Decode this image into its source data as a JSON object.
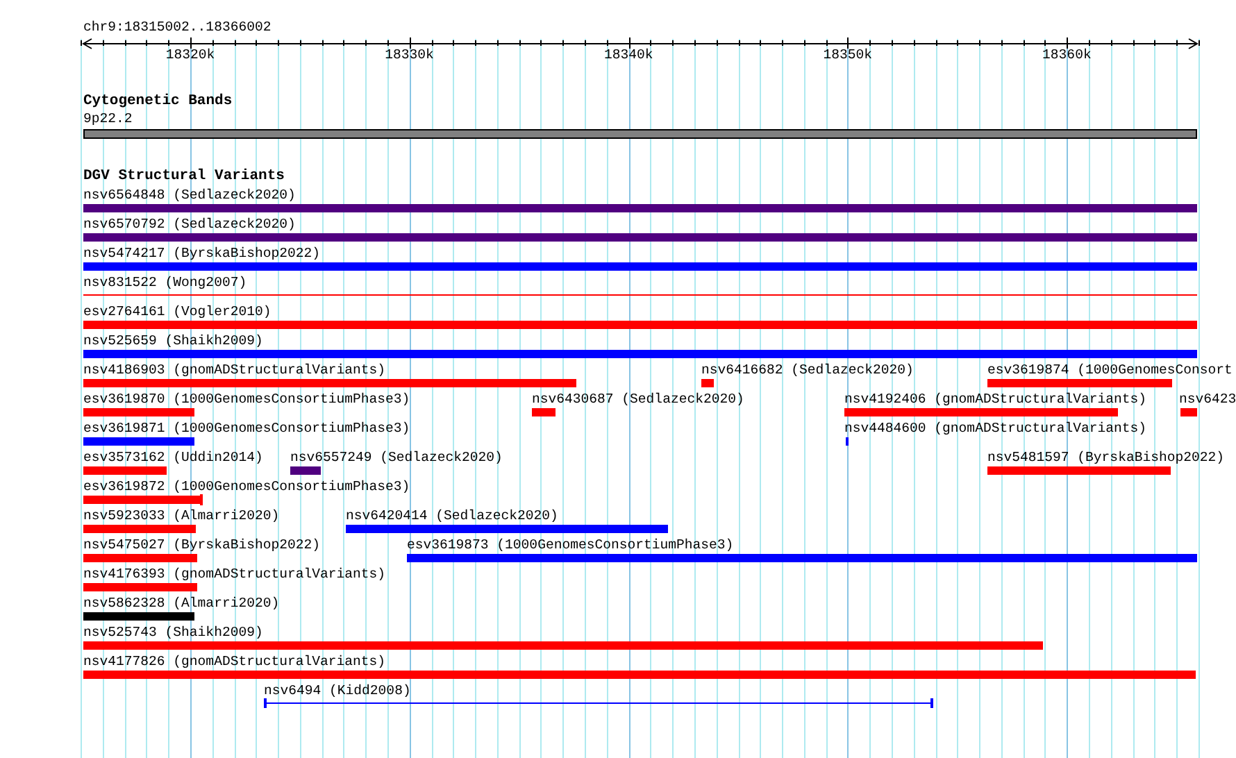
{
  "ruler": {
    "range": "chr9:18315002..18366002",
    "ticks": [
      "18320k",
      "18330k",
      "18340k",
      "18350k",
      "18360k"
    ]
  },
  "cytoband_track": {
    "title": "Cytogenetic Bands",
    "band": {
      "label": "9p22.2"
    }
  },
  "variant_track": {
    "title": "DGV Structural Variants",
    "rows": [
      {
        "features": [
          {
            "label": "nsv6564848 (Sedlazeck2020)",
            "color": "#500080",
            "kind": "bar"
          }
        ]
      },
      {
        "features": [
          {
            "label": "nsv6570792 (Sedlazeck2020)",
            "color": "#500080",
            "kind": "bar"
          }
        ]
      },
      {
        "features": [
          {
            "label": "nsv5474217 (ByrskaBishop2022)",
            "color": "#0000ff",
            "kind": "bar"
          }
        ]
      },
      {
        "features": [
          {
            "label": "nsv831522 (Wong2007)",
            "color": "#ff0000",
            "kind": "line"
          }
        ]
      },
      {
        "features": [
          {
            "label": "esv2764161 (Vogler2010)",
            "color": "#ff0000",
            "kind": "bar"
          }
        ]
      },
      {
        "features": [
          {
            "label": "nsv525659 (Shaikh2009)",
            "color": "#0000ff",
            "kind": "bar"
          }
        ]
      },
      {
        "features": [
          {
            "label": "nsv4186903 (gnomADStructuralVariants)",
            "color": "#ff0000",
            "kind": "bar"
          },
          {
            "label": "nsv6416682 (Sedlazeck2020)",
            "color": "#ff0000",
            "kind": "bar"
          },
          {
            "label": "esv3619874 (1000GenomesConsort",
            "color": "#ff0000",
            "kind": "bar"
          }
        ]
      },
      {
        "features": [
          {
            "label": "esv3619870 (1000GenomesConsortiumPhase3)",
            "color": "#ff0000",
            "kind": "bar"
          },
          {
            "label": "nsv6430687 (Sedlazeck2020)",
            "color": "#ff0000",
            "kind": "bar"
          },
          {
            "label": "nsv4192406 (gnomADStructuralVariants)",
            "color": "#ff0000",
            "kind": "bar"
          },
          {
            "label": "nsv6423",
            "color": "#ff0000",
            "kind": "bar"
          }
        ]
      },
      {
        "features": [
          {
            "label": "esv3619871 (1000GenomesConsortiumPhase3)",
            "color": "#0000ff",
            "kind": "bar"
          },
          {
            "label": "nsv4484600 (gnomADStructuralVariants)",
            "color": "#0000ff",
            "kind": "bar"
          }
        ]
      },
      {
        "features": [
          {
            "label": "esv3573162 (Uddin2014)",
            "color": "#ff0000",
            "kind": "bar"
          },
          {
            "label": "nsv6557249 (Sedlazeck2020)",
            "color": "#500080",
            "kind": "bar"
          },
          {
            "label": "nsv5481597 (ByrskaBishop2022)",
            "color": "#ff0000",
            "kind": "bar"
          }
        ]
      },
      {
        "features": [
          {
            "label": "esv3619872 (1000GenomesConsortiumPhase3)",
            "color": "#ff0000",
            "kind": "capped-bar"
          }
        ]
      },
      {
        "features": [
          {
            "label": "nsv5923033 (Almarri2020)",
            "color": "#ff0000",
            "kind": "bar"
          },
          {
            "label": "nsv6420414 (Sedlazeck2020)",
            "color": "#0000ff",
            "kind": "bar"
          }
        ]
      },
      {
        "features": [
          {
            "label": "nsv5475027 (ByrskaBishop2022)",
            "color": "#ff0000",
            "kind": "bar"
          },
          {
            "label": "esv3619873 (1000GenomesConsortiumPhase3)",
            "color": "#0000ff",
            "kind": "bar"
          }
        ]
      },
      {
        "features": [
          {
            "label": "nsv4176393 (gnomADStructuralVariants)",
            "color": "#ff0000",
            "kind": "bar"
          }
        ]
      },
      {
        "features": [
          {
            "label": "nsv5862328 (Almarri2020)",
            "color": "#000000",
            "kind": "bar"
          }
        ]
      },
      {
        "features": [
          {
            "label": "nsv525743 (Shaikh2009)",
            "color": "#ff0000",
            "kind": "bar"
          }
        ]
      },
      {
        "features": [
          {
            "label": "nsv4177826 (gnomADStructuralVariants)",
            "color": "#ff0000",
            "kind": "bar"
          }
        ]
      },
      {
        "features": [
          {
            "label": "nsv6494 (Kidd2008)",
            "color": "#0000ff",
            "kind": "capped-line"
          }
        ]
      }
    ]
  }
}
